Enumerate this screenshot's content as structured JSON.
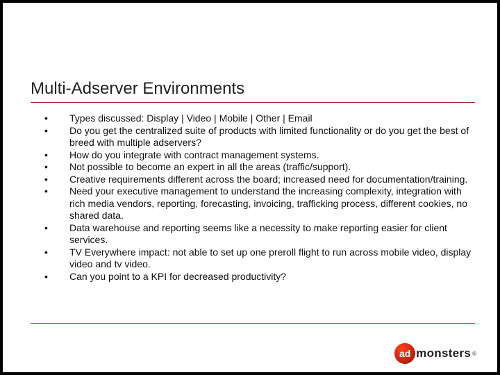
{
  "title": "Multi-Adserver Environments",
  "bullets": [
    "Types discussed: Display | Video | Mobile | Other | Email",
    "Do you get the centralized suite of products with limited functionality or do you get the best of breed with multiple adservers?",
    "How do you integrate with contract management systems.",
    "Not possible to become an expert in all the areas (traffic/support).",
    "Creative requirements different across the board; increased need for documentation/training.",
    "Need your executive management to understand the increasing complexity, integration with rich media vendors, reporting, forecasting, invoicing, trafficking process, different cookies, no shared data.",
    "Data warehouse and reporting seems like a necessity to make reporting easier for client services.",
    "TV Everywhere impact: not able to set up one preroll flight to run across mobile video, display video and tv video.",
    "Can you point to a KPI for decreased productivity?"
  ],
  "logo": {
    "ad_text": "ad",
    "monsters_text": "monsters"
  }
}
